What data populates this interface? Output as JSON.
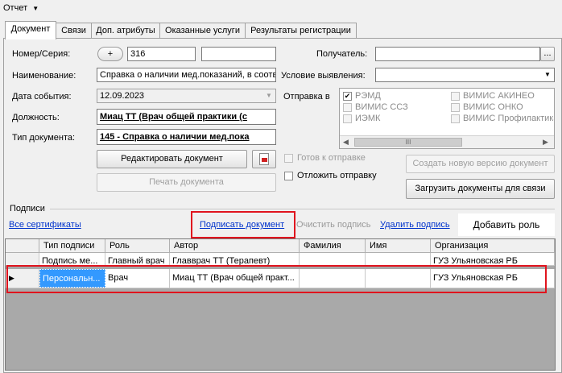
{
  "menu": {
    "report": "Отчет"
  },
  "tabs": [
    "Документ",
    "Связи",
    "Доп. атрибуты",
    "Оказанные услуги",
    "Результаты регистрации"
  ],
  "form": {
    "number_label": "Номер/Серия:",
    "add_symbol": "+",
    "number_value": "316",
    "series_value": "",
    "recipient_label": "Получатель:",
    "recipient_value": "",
    "recipient_browse": "...",
    "name_label": "Наименование:",
    "name_value": "Справка о наличии мед.показаний, в соответ",
    "condition_label": "Условие выявления:",
    "condition_value": "",
    "event_date_label": "Дата события:",
    "event_date_value": "12.09.2023",
    "send_to_label": "Отправка в",
    "position_label": "Должность:",
    "position_value": "Миац ТТ (Врач общей практики (с",
    "doc_type_label": "Тип документа:",
    "doc_type_value": "145 - Справка о наличии мед.пока",
    "send_targets": [
      {
        "label": "РЭМД",
        "checked": true
      },
      {
        "label": "ВИМИС АКИНЕО",
        "checked": false
      },
      {
        "label": "ВИМИС ССЗ",
        "checked": false
      },
      {
        "label": "ВИМИС ОНКО",
        "checked": false
      },
      {
        "label": "ИЭМК",
        "checked": false
      },
      {
        "label": "ВИМИС Профилактика",
        "checked": false
      }
    ],
    "scroll_handle": "III"
  },
  "buttons": {
    "edit_document": "Редактировать документ",
    "print_document": "Печать документа",
    "ready_to_send": "Готов к отправке",
    "postpone_send": "Отложить отправку",
    "create_version": "Создать новую версию документ",
    "upload_documents": "Загрузить документы для связи"
  },
  "signatures": {
    "group_label": "Подписи",
    "all_certificates": "Все сертификаты",
    "sign_document": "Подписать документ",
    "clear_signature": "Очистить подпись",
    "delete_signature": "Удалить подпись",
    "add_role": "Добавить роль",
    "columns": [
      "Тип подписи",
      "Роль",
      "Автор",
      "Фамилия",
      "Имя",
      "Организация"
    ],
    "rows": [
      [
        "Подпись ме...",
        "Главный врач",
        "Главврач ТТ (Терапевт)",
        "",
        "",
        "ГУЗ Ульяновская РБ"
      ],
      [
        "Персональн...",
        "Врач",
        "Миац ТТ (Врач общей практ...",
        "",
        "",
        "ГУЗ Ульяновская РБ"
      ]
    ]
  },
  "colors": {
    "highlight_box": "#e0141e",
    "link": "#0033cc",
    "selected_cell": "#3399ff"
  }
}
